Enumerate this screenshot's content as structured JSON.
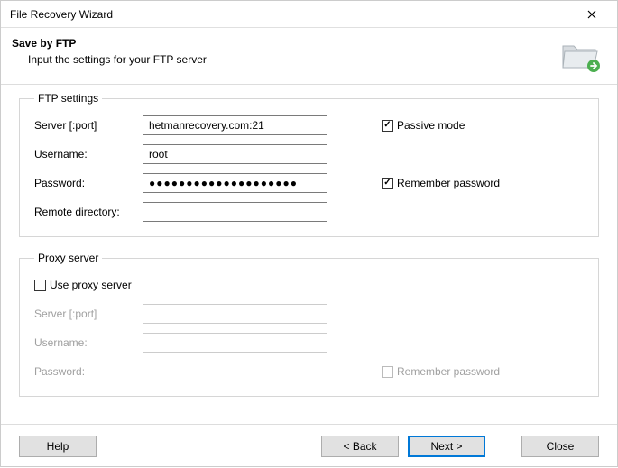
{
  "window": {
    "title": "File Recovery Wizard"
  },
  "header": {
    "title": "Save by FTP",
    "subtitle": "Input the settings for your FTP server"
  },
  "ftp": {
    "legend": "FTP settings",
    "server_label": "Server [:port]",
    "server_value": "hetmanrecovery.com:21",
    "username_label": "Username:",
    "username_value": "root",
    "password_label": "Password:",
    "password_value": "●●●●●●●●●●●●●●●●●●●●",
    "remote_dir_label": "Remote directory:",
    "remote_dir_value": "",
    "passive_label": "Passive mode",
    "remember_label": "Remember password"
  },
  "proxy": {
    "legend": "Proxy server",
    "use_proxy_label": "Use proxy server",
    "server_label": "Server [:port]",
    "server_value": "",
    "username_label": "Username:",
    "username_value": "",
    "password_label": "Password:",
    "password_value": "",
    "remember_label": "Remember password"
  },
  "buttons": {
    "help": "Help",
    "back": "< Back",
    "next": "Next >",
    "close": "Close"
  }
}
